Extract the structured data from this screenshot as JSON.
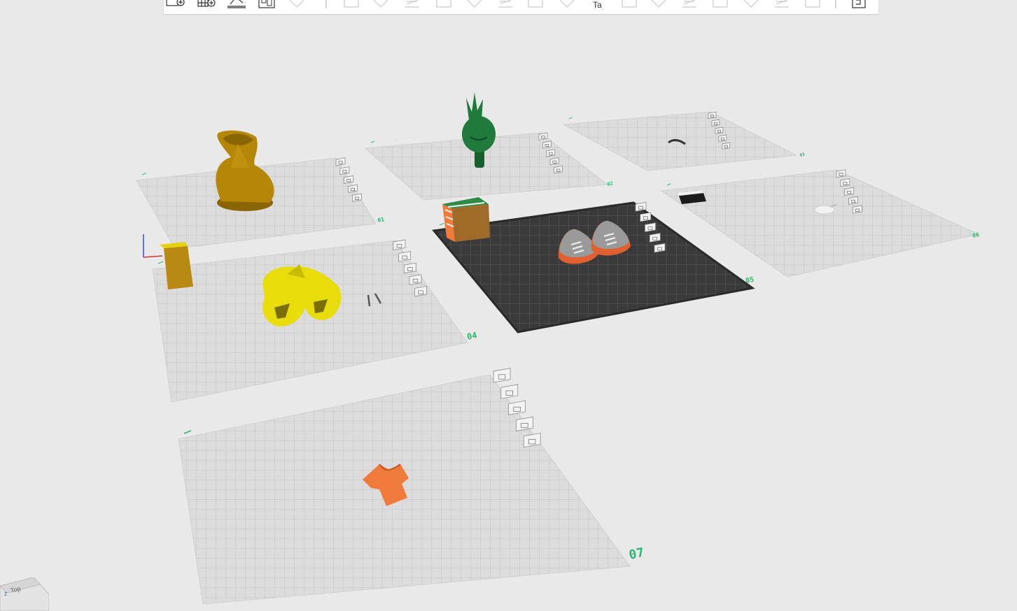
{
  "toolbar": {
    "tools": [
      {
        "name": "add-object-icon",
        "interactable": true
      },
      {
        "name": "add-plate-icon",
        "interactable": true
      },
      {
        "name": "orient-icon",
        "interactable": true
      },
      {
        "name": "arrange-icon",
        "interactable": true
      },
      {
        "name": "layers-icon",
        "interactable": false
      },
      {
        "name": "separator",
        "interactable": false
      },
      {
        "name": "move-icon",
        "interactable": false
      },
      {
        "name": "rotate-icon",
        "interactable": false
      },
      {
        "name": "scale-icon",
        "interactable": false
      },
      {
        "name": "lay-on-face-icon",
        "interactable": false
      },
      {
        "name": "cut-icon",
        "interactable": false
      },
      {
        "name": "mesh-boolean-icon",
        "interactable": false
      },
      {
        "name": "support-paint-icon",
        "interactable": false
      },
      {
        "name": "seam-paint-icon",
        "interactable": false
      },
      {
        "name": "text-icon",
        "interactable": false
      },
      {
        "name": "split-objects-icon",
        "interactable": false
      },
      {
        "name": "split-parts-icon",
        "interactable": false
      },
      {
        "name": "measure-icon",
        "interactable": false
      },
      {
        "name": "fuzzy-skin-icon",
        "interactable": false
      },
      {
        "name": "assembly-icon",
        "interactable": false
      },
      {
        "name": "brim-ears-icon",
        "interactable": false
      },
      {
        "name": "emboss-icon",
        "interactable": false
      },
      {
        "name": "separator",
        "interactable": false
      },
      {
        "name": "variable-layer-height-icon",
        "interactable": true
      }
    ],
    "text_tool_glyph": "Ta"
  },
  "plates": [
    {
      "label": "01",
      "active": false
    },
    {
      "label": "02",
      "active": false
    },
    {
      "label": "03",
      "active": false
    },
    {
      "label": "04",
      "active": false
    },
    {
      "label": "05",
      "active": true
    },
    {
      "label": "06",
      "active": false
    },
    {
      "label": "07",
      "active": false
    }
  ],
  "plate_buttons": [
    "close-plate-icon",
    "auto-orient-plate-icon",
    "arrange-plate-icon",
    "lock-plate-icon",
    "plate-settings-icon"
  ],
  "models": [
    {
      "name": "hooded-figure-model",
      "color": "#b58608"
    },
    {
      "name": "grinch-head-model",
      "color": "#1f7a3c"
    },
    {
      "name": "small-curve-model",
      "color": "#333333"
    },
    {
      "name": "black-box-model",
      "color": "#1c1c1c"
    },
    {
      "name": "white-mouse-model",
      "color": "#f2f2f2"
    },
    {
      "name": "yellow-block-model",
      "color": "#b88a12"
    },
    {
      "name": "yellow-duck-feet-model",
      "color": "#e8dc0a"
    },
    {
      "name": "pin-pair-model",
      "color": "#555555"
    },
    {
      "name": "multi-color-cube-model",
      "color": "#a06a28"
    },
    {
      "name": "sneakers-model",
      "color": "#e06030"
    },
    {
      "name": "orange-shirt-model",
      "color": "#f07a3c"
    }
  ],
  "colors": {
    "background": "#e9e9e9",
    "plate_fill": "#dcdcdc",
    "plate_grid": "#c4c4c4",
    "active_plate_fill": "#3a3a3a",
    "active_plate_grid": "#5c5c5c",
    "plate_label": "#2bb673"
  },
  "view_cube": {
    "face_label": "Top",
    "axis_label": "Z"
  }
}
